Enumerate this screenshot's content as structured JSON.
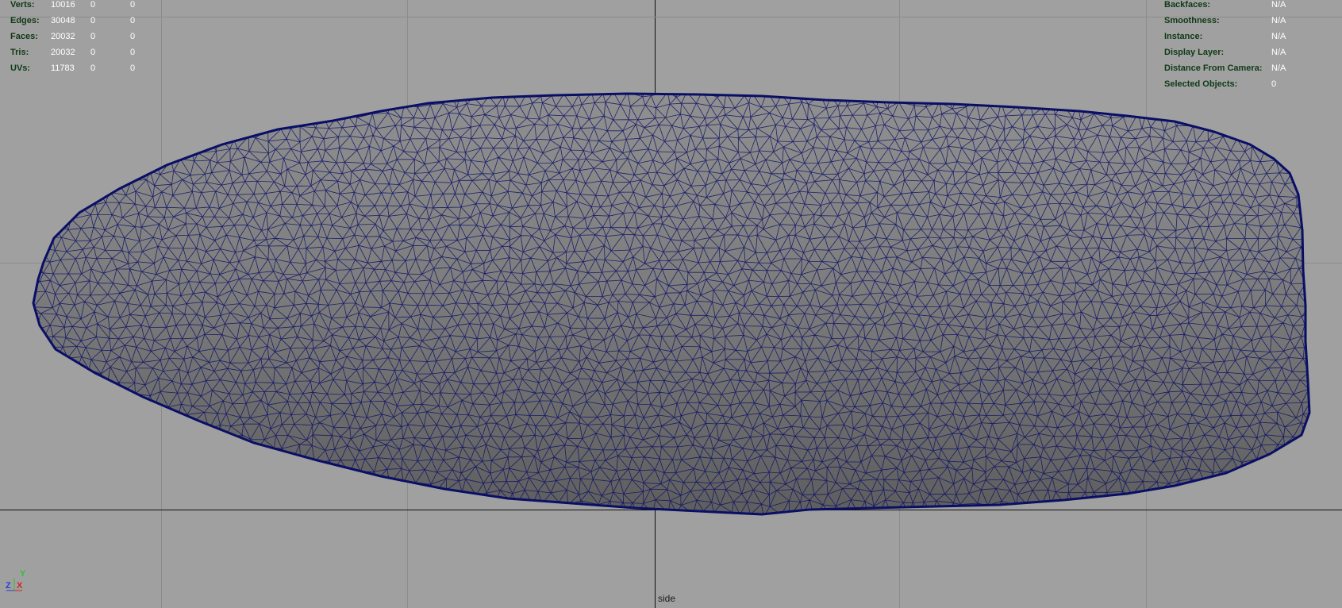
{
  "viewport": {
    "camera": "side",
    "background_color": "#a0a0a0",
    "grid_color": "#8c8c8c",
    "axis_color": "#111111",
    "wire_color": "#0a0f66",
    "shade_color": "#7d7d7d"
  },
  "poly_count": {
    "rows": [
      {
        "label": "Verts:",
        "values": [
          "10016",
          "0",
          "0"
        ]
      },
      {
        "label": "Edges:",
        "values": [
          "30048",
          "0",
          "0"
        ]
      },
      {
        "label": "Faces:",
        "values": [
          "20032",
          "0",
          "0"
        ]
      },
      {
        "label": "Tris:",
        "values": [
          "20032",
          "0",
          "0"
        ]
      },
      {
        "label": "UVs:",
        "values": [
          "11783",
          "0",
          "0"
        ]
      }
    ]
  },
  "object_details": {
    "rows": [
      {
        "label": "Backfaces:",
        "value": "N/A"
      },
      {
        "label": "Smoothness:",
        "value": "N/A"
      },
      {
        "label": "Instance:",
        "value": "N/A"
      },
      {
        "label": "Display Layer:",
        "value": "N/A"
      },
      {
        "label": "Distance From Camera:",
        "value": "N/A"
      },
      {
        "label": "Selected Objects:",
        "value": "0"
      }
    ]
  },
  "axis_gizmo": {
    "y_label": "Y",
    "z_label": "Z",
    "x_label": "X",
    "y_color": "#2ec22e",
    "z_color": "#2a3fd6",
    "x_color": "#d42020"
  }
}
